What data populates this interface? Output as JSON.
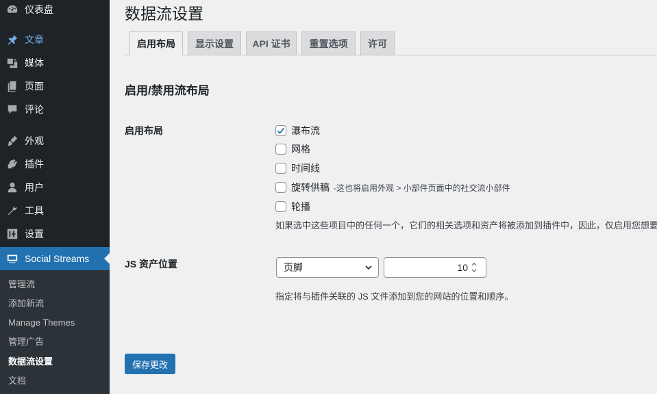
{
  "sidebar": {
    "menu": [
      {
        "label": "仪表盘",
        "icon": "dashboard-icon"
      },
      {
        "label": "文章",
        "icon": "pin-icon"
      },
      {
        "label": "媒体",
        "icon": "media-icon"
      },
      {
        "label": "页面",
        "icon": "page-icon"
      },
      {
        "label": "评论",
        "icon": "comment-icon"
      },
      {
        "label": "外观",
        "icon": "appearance-icon"
      },
      {
        "label": "插件",
        "icon": "plugin-icon"
      },
      {
        "label": "用户",
        "icon": "user-icon"
      },
      {
        "label": "工具",
        "icon": "wrench-icon"
      },
      {
        "label": "设置",
        "icon": "settings-icon"
      },
      {
        "label": "Social Streams",
        "icon": "social-streams-icon"
      }
    ],
    "submenu": [
      "管理流",
      "添加新流",
      "Manage Themes",
      "管理广告",
      "数据流设置",
      "文档"
    ]
  },
  "page": {
    "title": "数据流设置",
    "tabs": [
      "启用布局",
      "显示设置",
      "API 证书",
      "重置选项",
      "许可"
    ],
    "section_heading": "启用/禁用流布局",
    "layouts": {
      "label": "启用布局",
      "options": [
        {
          "label": "瀑布流",
          "checked": true
        },
        {
          "label": "网格",
          "checked": false
        },
        {
          "label": "时间线",
          "checked": false
        },
        {
          "label": "旋转供稿",
          "checked": false,
          "note": "-这也将启用外观 > 小部件页面中的社交流小部件"
        },
        {
          "label": "轮播",
          "checked": false
        }
      ],
      "description": "如果选中这些项目中的任何一个，它们的相关选项和资产将被添加到插件中，因此，仅启用您想要"
    },
    "js_assets": {
      "label": "JS 资产位置",
      "position_value": "页脚",
      "order_value": "10",
      "description": "指定将与插件关联的 JS 文件添加到您的网站的位置和顺序。"
    },
    "save_label": "保存更改"
  },
  "colors": {
    "sidebar_bg": "#1d2327",
    "submenu_bg": "#2c3338",
    "accent": "#2271b1",
    "page_bg": "#f0f0f1"
  }
}
